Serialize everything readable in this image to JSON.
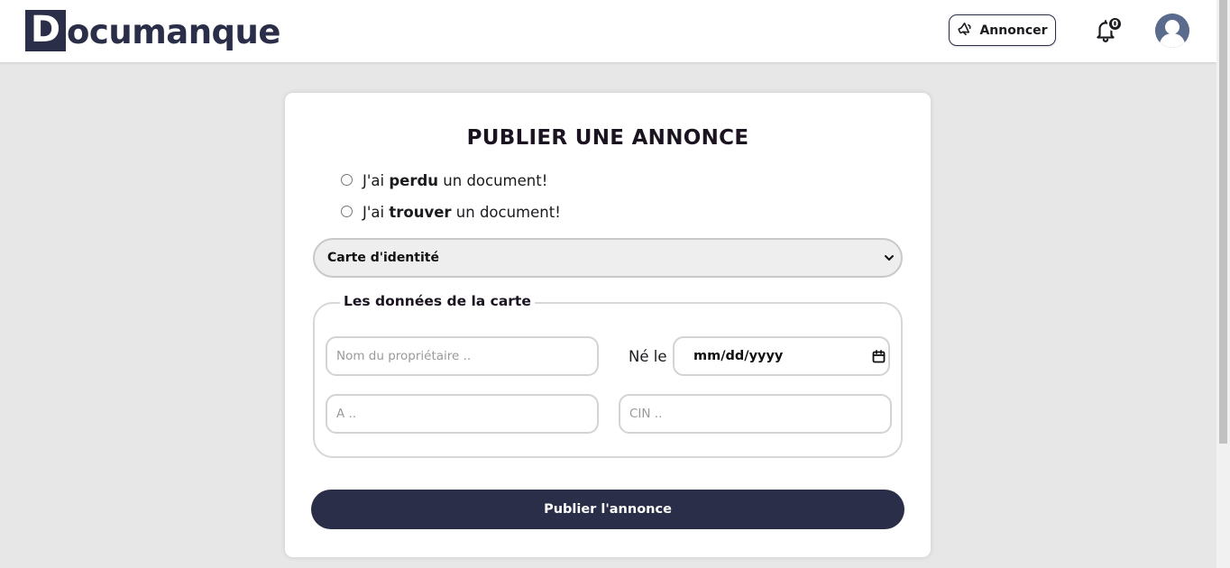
{
  "header": {
    "logo_letter": "D",
    "logo_rest": "ocumanque",
    "announce_label": "Annoncer",
    "notification_count": "0"
  },
  "form": {
    "title": "PUBLIER UNE ANNONCE",
    "option_lost": {
      "before": "J'ai ",
      "bold": "perdu",
      "after": " un document!"
    },
    "option_found": {
      "before": "J'ai ",
      "bold": "trouver",
      "after": " un document!"
    },
    "document_type_selected": "Carte d'identité",
    "card_data_legend": "Les données de la carte",
    "owner_name_placeholder": "Nom du propriétaire ..",
    "born_label": "Né le",
    "date_value": "mm/dd/yyyy",
    "place_placeholder": "A ..",
    "cin_placeholder": "CIN ..",
    "submit_label": "Publier l'annonce"
  },
  "colors": {
    "primary": "#2b2e48",
    "background": "#e7e7e7",
    "card": "#ffffff"
  },
  "icons": {
    "announce": "megaphone-icon",
    "notifications": "bell-icon",
    "avatar": "user-avatar-icon",
    "select": "chevron-down-icon",
    "date": "calendar-icon"
  }
}
